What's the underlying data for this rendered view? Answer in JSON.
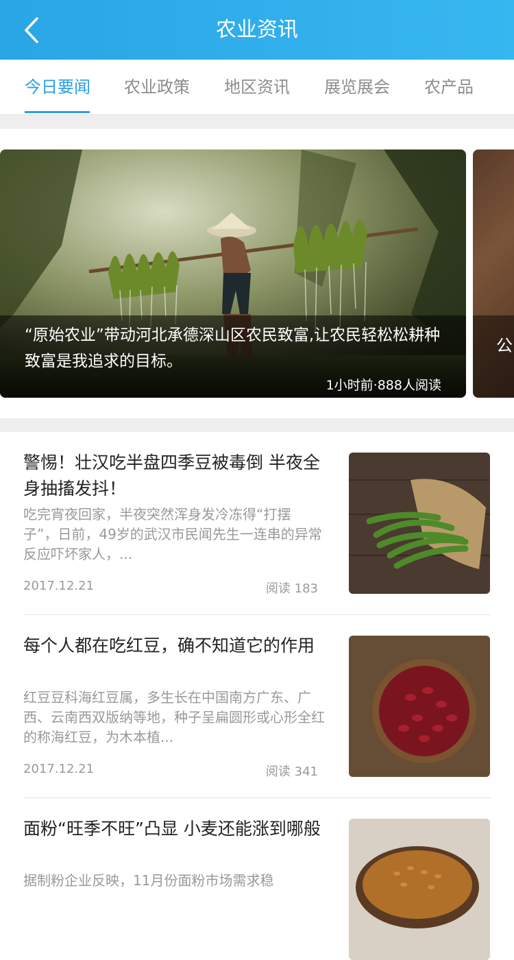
{
  "header": {
    "title": "农业资讯"
  },
  "tabs": [
    {
      "label": "今日要闻",
      "active": true
    },
    {
      "label": "农业政策",
      "active": false
    },
    {
      "label": "地区资讯",
      "active": false
    },
    {
      "label": "展览展会",
      "active": false
    },
    {
      "label": "农产品",
      "active": false
    }
  ],
  "banner": {
    "slides": [
      {
        "title": "“原始农业”带动河北承德深山区农民致富,让农民轻松松耕种致富是我追求的目标。",
        "meta": "1小时前·888人阅读"
      },
      {
        "title": "公"
      }
    ]
  },
  "articles": [
    {
      "title": "警惕！壮汉吃半盘四季豆被毒倒 半夜全身抽搐发抖！",
      "desc": "吃完宵夜回家，半夜突然浑身发冷冻得“打摆子”，日前，49岁的武汉市民闻先生一连串的异常反应吓坏家人，...",
      "date": "2017.12.21",
      "reads": "阅读 183"
    },
    {
      "title": "每个人都在吃红豆，确不知道它的作用",
      "desc": "红豆豆科海红豆属，多生长在中国南方广东、广西、云南西双版纳等地，种子呈扁圆形或心形全红的称海红豆，为木本植...",
      "date": "2017.12.21",
      "reads": "阅读 341"
    },
    {
      "title": "面粉“旺季不旺”凸显 小麦还能涨到哪般",
      "desc": "据制粉企业反映，11月份面粉市场需求稳"
    }
  ],
  "colors": {
    "header": "#2aa5e6",
    "accent": "#2a9ee5"
  }
}
